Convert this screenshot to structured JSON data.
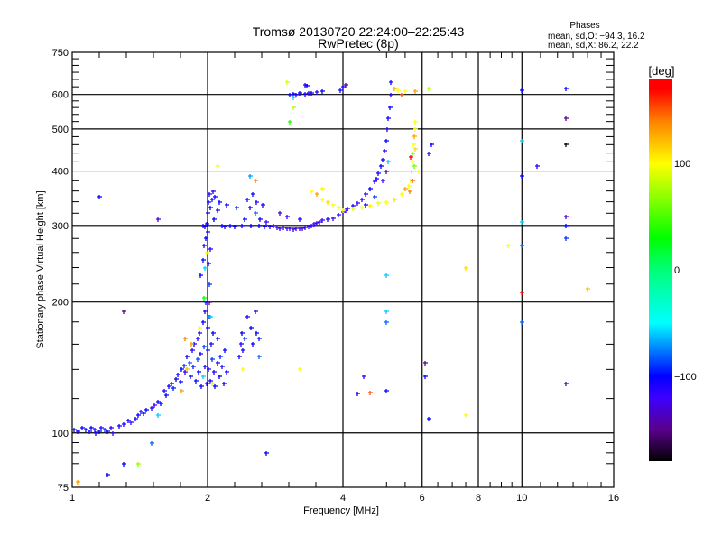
{
  "chart_data": {
    "type": "scatter",
    "title": "Tromsø 20130720 22:24:00–22:25:43",
    "subtitle": "RwPretec (8p)",
    "xlabel": "Frequency [MHz]",
    "ylabel": "Stationary phase Virtual Height [km]",
    "xscale": "log",
    "yscale": "log",
    "xlim": [
      1,
      16
    ],
    "ylim": [
      75,
      750
    ],
    "xticks": [
      1,
      2,
      4,
      6,
      8,
      10,
      16
    ],
    "xtick_labels": [
      "1",
      "2",
      "4",
      "6",
      "8",
      "10",
      "16"
    ],
    "xgrid": [
      2,
      4,
      6,
      8,
      10
    ],
    "yticks": [
      75,
      100,
      200,
      300,
      400,
      500,
      600,
      750
    ],
    "ytick_labels": [
      "75",
      "100",
      "200",
      "300",
      "400",
      "500",
      "600",
      "750"
    ],
    "ygrid": [
      100,
      200,
      300,
      400,
      500,
      600
    ],
    "grid": true,
    "stats": {
      "title": "Phases",
      "o_line": "mean, sd,O:  −94.3, 16.2",
      "x_line": "mean, sd,X:  86.2, 22.2"
    },
    "colorbar": {
      "label": "[deg]",
      "range": [
        -180,
        180
      ],
      "ticks": [
        100,
        0,
        -100
      ],
      "tick_labels": [
        "100",
        "0",
        "−100"
      ]
    },
    "point_format": [
      "frequency_MHz",
      "height_km",
      "phase_deg"
    ],
    "points": [
      [
        1.01,
        102,
        -110
      ],
      [
        1.03,
        101,
        -105
      ],
      [
        1.05,
        103,
        -100
      ],
      [
        1.07,
        102,
        -110
      ],
      [
        1.09,
        101,
        -95
      ],
      [
        1.1,
        103,
        -100
      ],
      [
        1.12,
        102,
        -110
      ],
      [
        1.13,
        100,
        -105
      ],
      [
        1.15,
        101,
        -100
      ],
      [
        1.16,
        103,
        -110
      ],
      [
        1.18,
        102,
        -90
      ],
      [
        1.2,
        101,
        -100
      ],
      [
        1.22,
        103,
        -110
      ],
      [
        1.23,
        100,
        -120
      ],
      [
        1.27,
        104,
        -105
      ],
      [
        1.3,
        105,
        -110
      ],
      [
        1.33,
        107,
        -100
      ],
      [
        1.35,
        106,
        -120
      ],
      [
        1.38,
        108,
        -110
      ],
      [
        1.4,
        110,
        -100
      ],
      [
        1.42,
        112,
        -115
      ],
      [
        1.44,
        111,
        -105
      ],
      [
        1.46,
        113,
        -100
      ],
      [
        1.5,
        114,
        -110
      ],
      [
        1.52,
        116,
        -120
      ],
      [
        1.55,
        118,
        -105
      ],
      [
        1.57,
        117,
        -100
      ],
      [
        1.6,
        125,
        -110
      ],
      [
        1.62,
        122,
        -100
      ],
      [
        1.64,
        128,
        -105
      ],
      [
        1.66,
        130,
        -110
      ],
      [
        1.68,
        127,
        -95
      ],
      [
        1.7,
        133,
        -100
      ],
      [
        1.72,
        136,
        -110
      ],
      [
        1.74,
        131,
        -105
      ],
      [
        1.75,
        140,
        -100
      ],
      [
        1.77,
        143,
        -90
      ],
      [
        1.78,
        138,
        -110
      ],
      [
        1.8,
        150,
        -100
      ],
      [
        1.82,
        145,
        -80
      ],
      [
        1.83,
        135,
        -100
      ],
      [
        1.85,
        155,
        -110
      ],
      [
        1.86,
        142,
        -95
      ],
      [
        1.87,
        160,
        -100
      ],
      [
        1.88,
        132,
        -105
      ],
      [
        1.9,
        165,
        -110
      ],
      [
        1.9,
        148,
        -85
      ],
      [
        1.91,
        138,
        -100
      ],
      [
        1.92,
        170,
        -105
      ],
      [
        1.93,
        152,
        -110
      ],
      [
        1.94,
        128,
        -100
      ],
      [
        1.95,
        180,
        -100
      ],
      [
        1.96,
        158,
        -90
      ],
      [
        1.97,
        190,
        -110
      ],
      [
        1.97,
        142,
        -100
      ],
      [
        1.98,
        200,
        -105
      ],
      [
        1.99,
        130,
        -110
      ],
      [
        2.0,
        175,
        -100
      ],
      [
        2.0,
        155,
        -95
      ],
      [
        2.01,
        140,
        -110
      ],
      [
        2.02,
        185,
        -100
      ],
      [
        2.03,
        132,
        -105
      ],
      [
        2.04,
        160,
        -110
      ],
      [
        2.05,
        148,
        -90
      ],
      [
        2.06,
        170,
        -100
      ],
      [
        2.07,
        138,
        -110
      ],
      [
        2.08,
        128,
        -100
      ],
      [
        2.1,
        145,
        -105
      ],
      [
        2.1,
        165,
        -110
      ],
      [
        2.12,
        135,
        -100
      ],
      [
        2.13,
        150,
        -95
      ],
      [
        2.15,
        142,
        -110
      ],
      [
        2.17,
        130,
        -100
      ],
      [
        2.18,
        155,
        -105
      ],
      [
        2.2,
        138,
        -110
      ],
      [
        1.84,
        160,
        130
      ],
      [
        1.8,
        140,
        120
      ],
      [
        1.78,
        165,
        140
      ],
      [
        1.92,
        175,
        100
      ],
      [
        2.05,
        130,
        90
      ],
      [
        1.75,
        125,
        130
      ],
      [
        1.95,
        135,
        -60
      ],
      [
        2.35,
        150,
        -100
      ],
      [
        2.37,
        160,
        -110
      ],
      [
        2.38,
        170,
        -100
      ],
      [
        2.4,
        155,
        -105
      ],
      [
        2.42,
        165,
        -90
      ],
      [
        2.45,
        185,
        -110
      ],
      [
        2.5,
        175,
        -100
      ],
      [
        2.52,
        160,
        -105
      ],
      [
        2.55,
        190,
        -110
      ],
      [
        2.57,
        170,
        -100
      ],
      [
        2.6,
        165,
        -95
      ],
      [
        2.4,
        140,
        100
      ],
      [
        2.6,
        150,
        -80
      ],
      [
        1.93,
        230,
        -100
      ],
      [
        1.95,
        250,
        -105
      ],
      [
        1.96,
        270,
        -110
      ],
      [
        1.97,
        240,
        -60
      ],
      [
        1.98,
        280,
        -100
      ],
      [
        1.99,
        260,
        100
      ],
      [
        2.0,
        290,
        -105
      ],
      [
        2.01,
        245,
        -100
      ],
      [
        2.02,
        220,
        -90
      ],
      [
        2.03,
        265,
        -110
      ],
      [
        1.96,
        205,
        30
      ],
      [
        2.02,
        200,
        -150
      ],
      [
        2.03,
        185,
        -60
      ],
      [
        1.95,
        300,
        -105
      ],
      [
        1.97,
        298,
        -100
      ],
      [
        1.99,
        302,
        -110
      ],
      [
        2.0,
        320,
        -100
      ],
      [
        2.01,
        340,
        -105
      ],
      [
        2.02,
        355,
        -110
      ],
      [
        2.03,
        330,
        -100
      ],
      [
        2.05,
        345,
        -95
      ],
      [
        2.06,
        360,
        -110
      ],
      [
        2.07,
        310,
        -100
      ],
      [
        2.08,
        350,
        -105
      ],
      [
        2.1,
        325,
        -110
      ],
      [
        2.12,
        340,
        -100
      ],
      [
        2.15,
        300,
        -105
      ],
      [
        2.18,
        298,
        -110
      ],
      [
        2.2,
        335,
        -100
      ],
      [
        2.25,
        300,
        -105
      ],
      [
        2.3,
        298,
        -100
      ],
      [
        2.32,
        330,
        -90
      ],
      [
        2.38,
        300,
        -110
      ],
      [
        2.42,
        310,
        -100
      ],
      [
        2.45,
        345,
        -95
      ],
      [
        2.48,
        330,
        -110
      ],
      [
        2.5,
        300,
        -100
      ],
      [
        2.52,
        355,
        -105
      ],
      [
        2.55,
        320,
        -80
      ],
      [
        2.57,
        340,
        -110
      ],
      [
        2.6,
        300,
        -100
      ],
      [
        2.62,
        310,
        -105
      ],
      [
        2.65,
        335,
        -110
      ],
      [
        2.68,
        298,
        -100
      ],
      [
        2.7,
        305,
        -120
      ],
      [
        2.75,
        298,
        -110
      ],
      [
        2.8,
        300,
        -125
      ],
      [
        2.85,
        297,
        -120
      ],
      [
        2.9,
        296,
        -115
      ],
      [
        2.95,
        297,
        -125
      ],
      [
        3.0,
        295,
        -120
      ],
      [
        3.05,
        296,
        -115
      ],
      [
        3.1,
        294,
        -125
      ],
      [
        3.15,
        295,
        -120
      ],
      [
        3.2,
        296,
        -125
      ],
      [
        3.25,
        295,
        -130
      ],
      [
        3.3,
        297,
        -120
      ],
      [
        3.35,
        299,
        -125
      ],
      [
        3.4,
        300,
        -115
      ],
      [
        3.45,
        302,
        -120
      ],
      [
        3.5,
        304,
        -125
      ],
      [
        2.9,
        320,
        -130
      ],
      [
        3.0,
        315,
        -120
      ],
      [
        3.2,
        310,
        -115
      ],
      [
        2.55,
        380,
        140
      ],
      [
        2.48,
        390,
        -70
      ],
      [
        2.1,
        410,
        100
      ],
      [
        3.55,
        305,
        -120
      ],
      [
        3.6,
        308,
        -115
      ],
      [
        3.7,
        310,
        -110
      ],
      [
        3.8,
        312,
        -120
      ],
      [
        3.9,
        318,
        -115
      ],
      [
        4.0,
        322,
        -110
      ],
      [
        4.05,
        325,
        -120
      ],
      [
        4.1,
        328,
        -115
      ],
      [
        4.2,
        333,
        -110
      ],
      [
        4.3,
        338,
        -120
      ],
      [
        4.4,
        345,
        -115
      ],
      [
        4.5,
        355,
        -110
      ],
      [
        4.6,
        365,
        -100
      ],
      [
        4.7,
        378,
        -110
      ],
      [
        4.75,
        385,
        -105
      ],
      [
        4.8,
        395,
        -110
      ],
      [
        4.85,
        410,
        -100
      ],
      [
        4.9,
        425,
        -105
      ],
      [
        4.95,
        445,
        -110
      ],
      [
        5.0,
        470,
        -100
      ],
      [
        5.02,
        500,
        -110
      ],
      [
        5.05,
        530,
        -105
      ],
      [
        5.08,
        560,
        -100
      ],
      [
        5.1,
        600,
        -110
      ],
      [
        5.12,
        640,
        -105
      ],
      [
        4.7,
        350,
        -90
      ],
      [
        4.5,
        335,
        -100
      ],
      [
        4.9,
        380,
        -120
      ],
      [
        5.0,
        400,
        -150
      ],
      [
        5.05,
        420,
        -60
      ],
      [
        3.6,
        345,
        100
      ],
      [
        3.7,
        340,
        110
      ],
      [
        3.8,
        335,
        100
      ],
      [
        3.9,
        330,
        95
      ],
      [
        4.0,
        325,
        100
      ],
      [
        4.2,
        328,
        90
      ],
      [
        4.4,
        330,
        100
      ],
      [
        4.6,
        333,
        105
      ],
      [
        4.8,
        337,
        95
      ],
      [
        5.0,
        340,
        100
      ],
      [
        5.2,
        345,
        110
      ],
      [
        5.4,
        355,
        100
      ],
      [
        5.5,
        365,
        130
      ],
      [
        5.6,
        370,
        100
      ],
      [
        5.65,
        380,
        95
      ],
      [
        5.68,
        400,
        110
      ],
      [
        5.7,
        420,
        100
      ],
      [
        5.72,
        440,
        60
      ],
      [
        5.74,
        460,
        100
      ],
      [
        5.76,
        480,
        130
      ],
      [
        5.78,
        500,
        95
      ],
      [
        5.8,
        520,
        100
      ],
      [
        5.62,
        360,
        140
      ],
      [
        5.66,
        430,
        170
      ],
      [
        5.7,
        380,
        150
      ],
      [
        5.75,
        410,
        60
      ],
      [
        5.8,
        450,
        110
      ],
      [
        3.4,
        360,
        100
      ],
      [
        3.5,
        355,
        130
      ],
      [
        3.6,
        365,
        95
      ],
      [
        3.05,
        600,
        -110
      ],
      [
        3.1,
        602,
        -105
      ],
      [
        3.15,
        598,
        -110
      ],
      [
        3.2,
        604,
        -100
      ],
      [
        3.3,
        603,
        -110
      ],
      [
        3.35,
        606,
        -115
      ],
      [
        3.4,
        604,
        -105
      ],
      [
        3.5,
        607,
        -110
      ],
      [
        3.6,
        610,
        -100
      ],
      [
        3.3,
        630,
        -110
      ],
      [
        3.32,
        628,
        -100
      ],
      [
        3.1,
        590,
        -60
      ],
      [
        3.0,
        640,
        90
      ],
      [
        3.1,
        560,
        80
      ],
      [
        3.05,
        520,
        40
      ],
      [
        3.95,
        615,
        -110
      ],
      [
        4.0,
        625,
        -105
      ],
      [
        4.05,
        630,
        -150
      ],
      [
        5.2,
        620,
        130
      ],
      [
        5.3,
        615,
        100
      ],
      [
        5.5,
        610,
        100
      ],
      [
        5.8,
        612,
        130
      ],
      [
        6.2,
        620,
        80
      ],
      [
        6.3,
        460,
        -100
      ],
      [
        6.2,
        440,
        -110
      ],
      [
        5.9,
        400,
        100
      ],
      [
        5.4,
        600,
        150
      ],
      [
        10,
        615,
        -100
      ],
      [
        10,
        470,
        -60
      ],
      [
        10,
        390,
        -100
      ],
      [
        10,
        305,
        -60
      ],
      [
        10,
        270,
        -80
      ],
      [
        10,
        210,
        170
      ],
      [
        10,
        180,
        -80
      ],
      [
        12.5,
        620,
        -100
      ],
      [
        12.5,
        530,
        -150
      ],
      [
        12.5,
        460,
        -180
      ],
      [
        12.5,
        315,
        -130
      ],
      [
        12.5,
        300,
        -100
      ],
      [
        12.5,
        280,
        -90
      ],
      [
        12.5,
        130,
        -140
      ],
      [
        14,
        215,
        120
      ],
      [
        10.8,
        410,
        -110
      ],
      [
        7.5,
        240,
        110
      ],
      [
        7.5,
        110,
        100
      ],
      [
        9.3,
        270,
        100
      ],
      [
        5,
        230,
        -60
      ],
      [
        5,
        190,
        -60
      ],
      [
        5,
        180,
        -80
      ],
      [
        5,
        125,
        -100
      ],
      [
        6.1,
        145,
        -150
      ],
      [
        6.1,
        135,
        -100
      ],
      [
        6.2,
        108,
        -100
      ],
      [
        4.3,
        123,
        -100
      ],
      [
        4.6,
        124,
        150
      ],
      [
        4.45,
        135,
        -120
      ],
      [
        3.2,
        140,
        100
      ],
      [
        2.7,
        90,
        -100
      ],
      [
        1.55,
        110,
        -60
      ],
      [
        1.5,
        95,
        -80
      ],
      [
        1.4,
        85,
        70
      ],
      [
        1.3,
        85,
        -100
      ],
      [
        1.2,
        80,
        -100
      ],
      [
        1.03,
        77,
        130
      ],
      [
        1.15,
        350,
        -100
      ],
      [
        1.3,
        190,
        -150
      ],
      [
        1.55,
        310,
        -130
      ]
    ]
  }
}
